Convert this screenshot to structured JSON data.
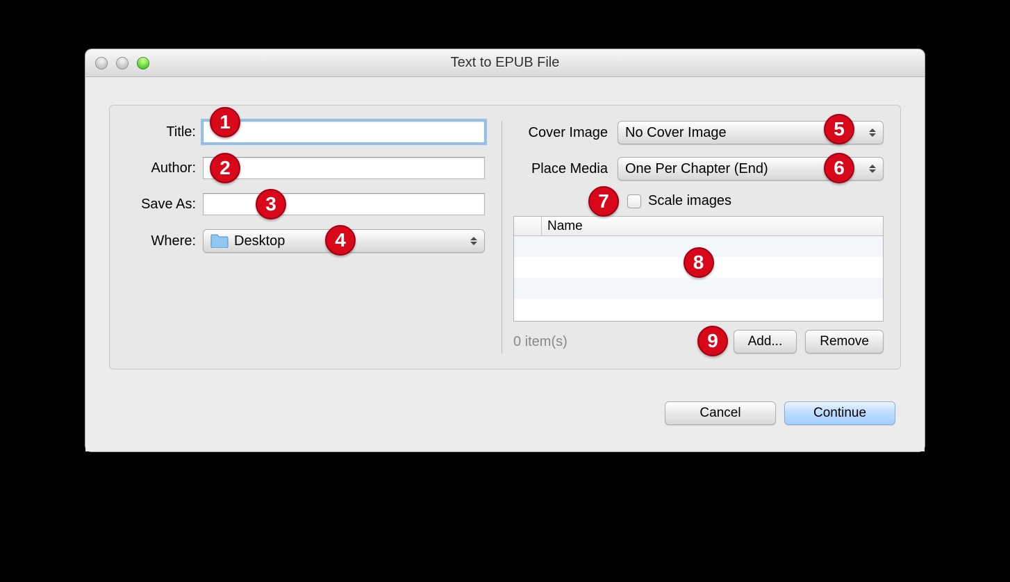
{
  "window": {
    "title": "Text to EPUB File"
  },
  "left": {
    "title_label": "Title:",
    "title_value": "",
    "author_label": "Author:",
    "author_value": "",
    "saveas_label": "Save As:",
    "saveas_value": "",
    "where_label": "Where:",
    "where_value": "Desktop"
  },
  "right": {
    "cover_label": "Cover Image",
    "cover_value": "No Cover Image",
    "place_label": "Place Media",
    "place_value": "One Per Chapter (End)",
    "scale_label": "Scale images",
    "table_header": "Name",
    "items_count": "0 item(s)",
    "add_label": "Add...",
    "remove_label": "Remove"
  },
  "footer": {
    "cancel": "Cancel",
    "continue": "Continue"
  },
  "badges": [
    "1",
    "2",
    "3",
    "4",
    "5",
    "6",
    "7",
    "8",
    "9"
  ]
}
